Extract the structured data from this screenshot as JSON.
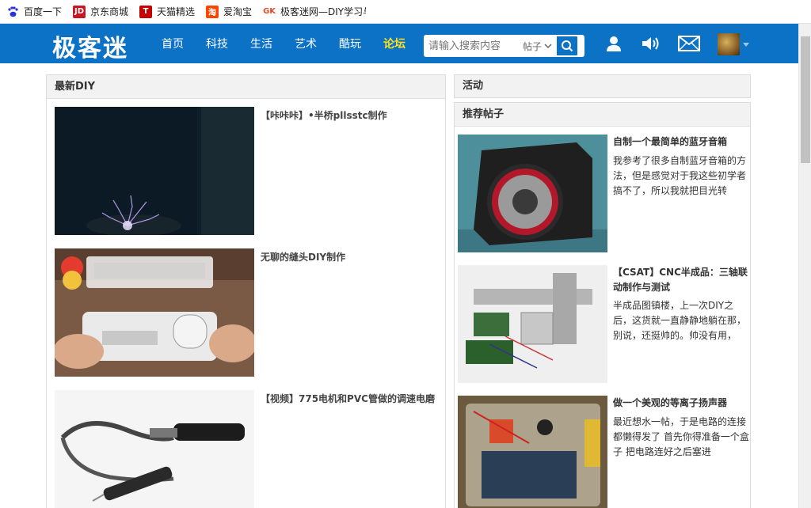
{
  "bookmarks": [
    {
      "label": "百度一下",
      "icon": "baidu-paw-icon",
      "color": "#2932e1"
    },
    {
      "label": "京东商城",
      "icon": "jd-icon",
      "color": "#c81623"
    },
    {
      "label": "天猫精选",
      "icon": "tmall-icon",
      "color": "#c40000"
    },
    {
      "label": "爱淘宝",
      "icon": "taobao-icon",
      "color": "#ff4400"
    },
    {
      "label": "极客迷网—DIY学习与",
      "icon": "gk-icon",
      "color": "#e24c2b"
    }
  ],
  "header": {
    "logo": "极客迷",
    "brand_color": "#0b72c6",
    "nav": [
      "首页",
      "科技",
      "生活",
      "艺术",
      "酷玩",
      "论坛"
    ],
    "active_nav": "论坛",
    "search_placeholder": "请输入搜索内容",
    "search_scope": "帖子"
  },
  "latest_diy": {
    "title": "最新DIY",
    "items": [
      {
        "title": "【咔咔咔】•半桥pllsstc制作"
      },
      {
        "title": "无聊的缝头DIY制作"
      },
      {
        "title": "【视频】775电机和PVC管做的调速电磨"
      }
    ]
  },
  "activity": {
    "title": "活动"
  },
  "recommended": {
    "title": "推荐帖子",
    "items": [
      {
        "title": "自制一个最简单的蓝牙音箱",
        "desc": "我参考了很多自制蓝牙音箱的方法，但是感觉对于我这些初学者搞不了，所以我就把目光转"
      },
      {
        "title": "【CSAT】CNC半成品：三轴联动制作与测试",
        "desc": "半成品图镇楼，上一次DIY之后，这货就一直静静地躺在那，别说，还挺帅的。帅没有用，"
      },
      {
        "title": "做一个美观的等离子扬声器",
        "desc": "最近想水一帖，于是电路的连接都懒得发了 首先你得准备一个盒子 把电路连好之后塞进"
      }
    ]
  }
}
